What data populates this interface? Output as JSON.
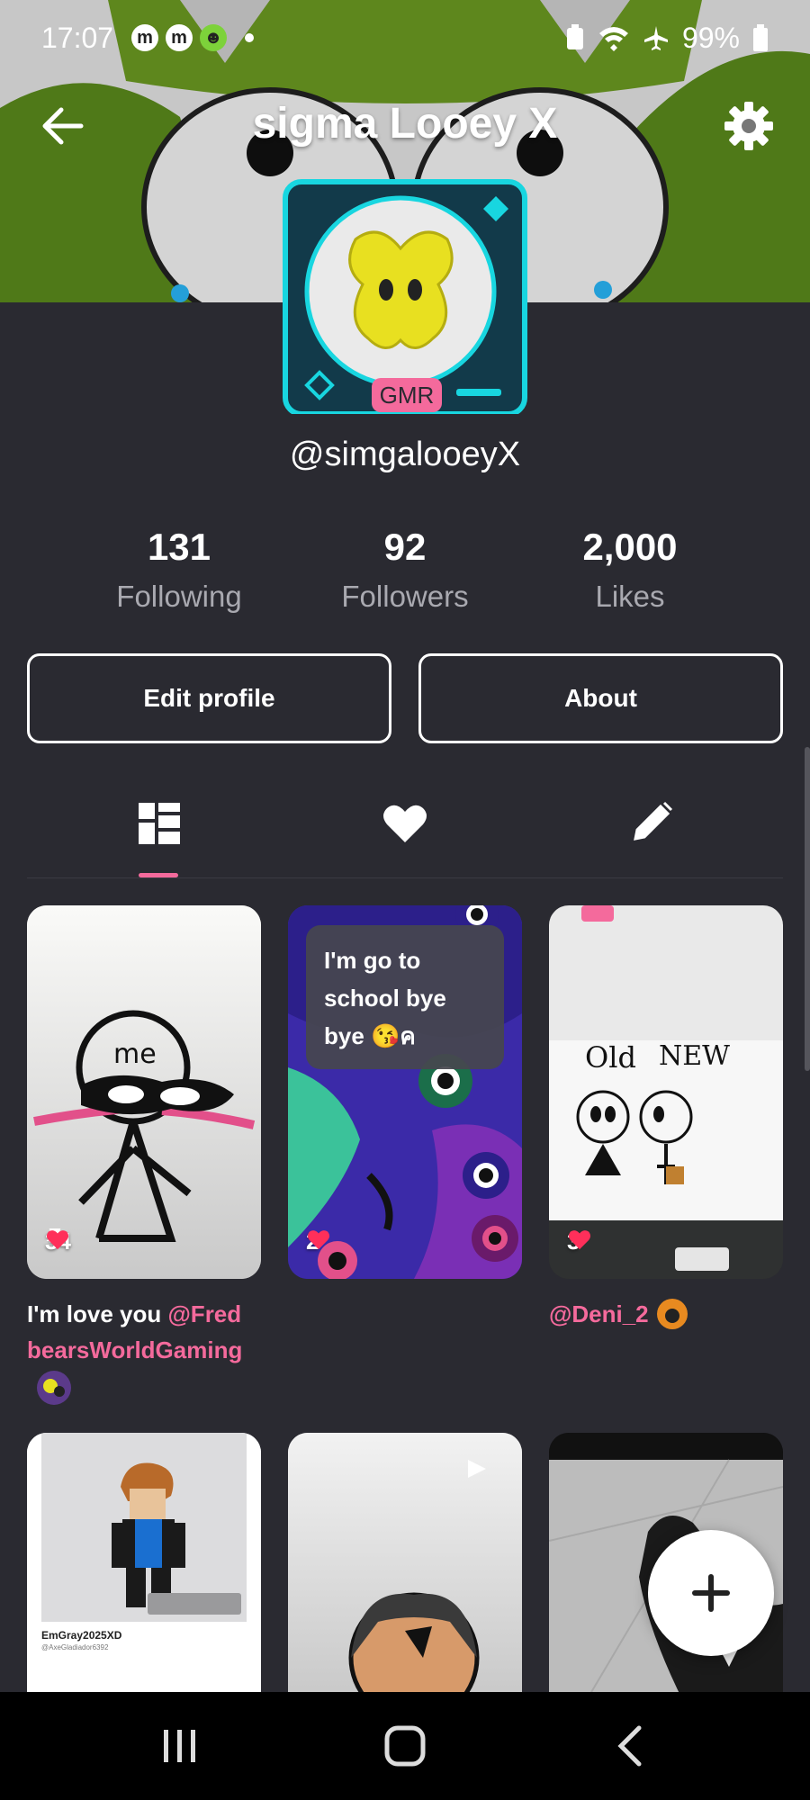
{
  "status_bar": {
    "time": "17:07",
    "battery": "99%",
    "app_icons": [
      "m-icon",
      "m-icon",
      "alien-icon"
    ]
  },
  "header": {
    "title": "sigma Looey X"
  },
  "profile": {
    "badge": "GMR",
    "handle": "@simgalooeyX",
    "stats": [
      {
        "value": "131",
        "label": "Following"
      },
      {
        "value": "92",
        "label": "Followers"
      },
      {
        "value": "2,000",
        "label": "Likes"
      }
    ],
    "buttons": {
      "edit": "Edit profile",
      "about": "About"
    }
  },
  "tabs": [
    {
      "name": "grid",
      "icon": "grid-icon",
      "active": true
    },
    {
      "name": "likes",
      "icon": "heart-icon",
      "active": false
    },
    {
      "name": "drafts",
      "icon": "pencil-icon",
      "active": false
    }
  ],
  "posts": [
    {
      "likes": "34",
      "pinned": true,
      "drawing_text": "me",
      "caption_text": "I'm love you ",
      "caption_mention": "@Fred bearsWorldGaming"
    },
    {
      "likes": "2",
      "bubble": "I'm go to school bye bye 😘ค"
    },
    {
      "likes": "3",
      "drawing_text_1": "Old",
      "drawing_text_2": "NEW",
      "caption_mention": "@Deni_2"
    },
    {
      "name_text": "EmGray2025XD",
      "sub_text": "@AxeGladiador6392"
    },
    {},
    {}
  ],
  "colors": {
    "accent": "#f46a9c",
    "background": "#2a2a31",
    "like": "#ff2f5a",
    "frame": "#18d6e0"
  }
}
